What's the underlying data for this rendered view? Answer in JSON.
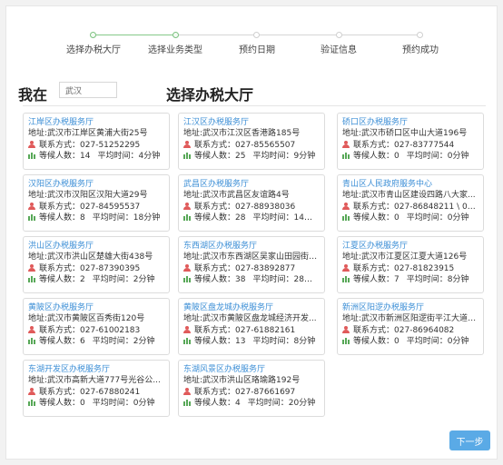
{
  "stepper": {
    "steps": [
      {
        "label": "选择办税大厅",
        "status": "done"
      },
      {
        "label": "选择业务类型",
        "status": "done"
      },
      {
        "label": "预约日期",
        "status": "pending"
      },
      {
        "label": "验证信息",
        "status": "pending"
      },
      {
        "label": "预约成功",
        "status": "pending"
      }
    ]
  },
  "location": {
    "label": "我在",
    "value": "武汉"
  },
  "page_title": "选择办税大厅",
  "card_labels": {
    "address": "地址:",
    "contact": "联系方式：",
    "waiting": "等候人数：",
    "avg_time": "平均时间："
  },
  "halls": [
    {
      "name": "江岸区办税服务厅",
      "address": "武汉市江岸区黄浦大街25号",
      "phone": "027-51252295",
      "waiting": "14",
      "avg_time": "4分钟"
    },
    {
      "name": "江汉区办税服务厅",
      "address": "武汉市江汉区香港路185号",
      "phone": "027-85565507",
      "waiting": "25",
      "avg_time": "9分钟"
    },
    {
      "name": "硚口区办税服务厅",
      "address": "武汉市硚口区中山大道196号",
      "phone": "027-83777544",
      "waiting": "0",
      "avg_time": "0分钟"
    },
    {
      "name": "汉阳区办税服务厅",
      "address": "武汉市汉阳区汉阳大道29号",
      "phone": "027-84595537",
      "waiting": "8",
      "avg_time": "18分钟"
    },
    {
      "name": "武昌区办税服务厅",
      "address": "武汉市武昌区友谊路4号",
      "phone": "027-88938036",
      "waiting": "28",
      "avg_time": "14分..."
    },
    {
      "name": "青山区人民政府服务中心",
      "address": "武汉市青山区建设四路八大家...",
      "phone": "027-86848211 \\ 02...",
      "waiting": "0",
      "avg_time": "0分钟"
    },
    {
      "name": "洪山区办税服务厅",
      "address": "武汉市洪山区楚雄大街438号",
      "phone": "027-87390395",
      "waiting": "2",
      "avg_time": "2分钟"
    },
    {
      "name": "东西湖区办税服务厅",
      "address": "武汉市东西湖区吴家山田园街1...",
      "phone": "027-83892877",
      "waiting": "38",
      "avg_time": "28分..."
    },
    {
      "name": "江夏区办税服务厅",
      "address": "武汉市江夏区江夏大道126号",
      "phone": "027-81823915",
      "waiting": "7",
      "avg_time": "8分钟"
    },
    {
      "name": "黄陂区办税服务厅",
      "address": "武汉市黄陂区百秀街120号",
      "phone": "027-61002183",
      "waiting": "6",
      "avg_time": "2分钟"
    },
    {
      "name": "黄陂区盘龙城办税服务厅",
      "address": "武汉市黄陂区盘龙城经济开发...",
      "phone": "027-61882161",
      "waiting": "13",
      "avg_time": "8分钟"
    },
    {
      "name": "新洲区阳逻办税服务厅",
      "address": "武汉市新洲区阳逻街平江大道8...",
      "phone": "027-86964082",
      "waiting": "0",
      "avg_time": "0分钟"
    },
    {
      "name": "东湖开发区办税服务厅",
      "address": "武汉市高新大道777号光谷公...",
      "phone": "027-67880241",
      "waiting": "0",
      "avg_time": "0分钟"
    },
    {
      "name": "东湖风景区办税服务厅",
      "address": "武汉市洪山区珞瑜路192号",
      "phone": "027-87661697",
      "waiting": "4",
      "avg_time": "20分钟"
    }
  ],
  "next_button": "下一步",
  "colors": {
    "accent": "#3d8fd6",
    "button": "#5aaae6",
    "done_step": "#86c98a",
    "person_icon": "#e05a5a",
    "queue_icon": "#58a858"
  }
}
